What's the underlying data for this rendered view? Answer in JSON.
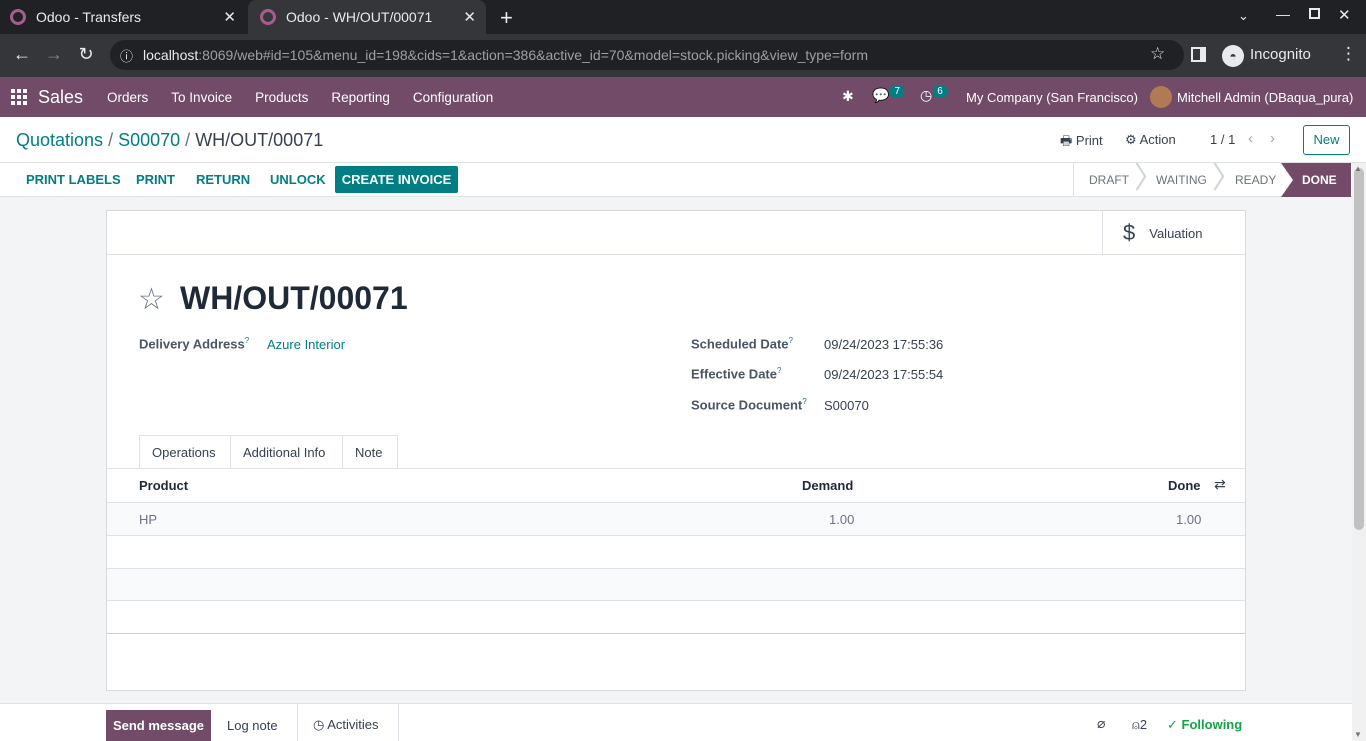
{
  "browser": {
    "tabs": [
      {
        "title": "Odoo - Transfers",
        "active": false
      },
      {
        "title": "Odoo - WH/OUT/00071",
        "active": true
      }
    ],
    "url_host": "localhost",
    "url_rest": ":8069/web#id=105&menu_id=198&cids=1&action=386&active_id=70&model=stock.picking&view_type=form",
    "incognito_label": "Incognito"
  },
  "navbar": {
    "app": "Sales",
    "menus": [
      "Orders",
      "To Invoice",
      "Products",
      "Reporting",
      "Configuration"
    ],
    "messages_count": "7",
    "activities_count": "6",
    "company": "My Company (San Francisco)",
    "user": "Mitchell Admin (DBaqua_pura)"
  },
  "control_panel": {
    "breadcrumb": [
      "Quotations",
      "S00070",
      "WH/OUT/00071"
    ],
    "print_label": "Print",
    "action_label": "Action",
    "pager": "1 / 1",
    "new_label": "New"
  },
  "statusbar": {
    "buttons": [
      "Print Labels",
      "Print",
      "Return",
      "Unlock"
    ],
    "create_invoice": "Create Invoice",
    "stages": [
      "DRAFT",
      "WAITING",
      "READY",
      "DONE"
    ],
    "current_stage": "DONE"
  },
  "form": {
    "valuation_label": "Valuation",
    "name": "WH/OUT/00071",
    "delivery_address_label": "Delivery Address",
    "delivery_address": "Azure Interior",
    "scheduled_date_label": "Scheduled Date",
    "scheduled_date": "09/24/2023 17:55:36",
    "effective_date_label": "Effective Date",
    "effective_date": "09/24/2023 17:55:54",
    "source_document_label": "Source Document",
    "source_document": "S00070",
    "tabs": [
      "Operations",
      "Additional Info",
      "Note"
    ],
    "columns": [
      "Product",
      "Demand",
      "Done"
    ],
    "lines": [
      {
        "product": "HP",
        "demand": "1.00",
        "done": "1.00"
      }
    ]
  },
  "chatter": {
    "send_message": "Send message",
    "log_note": "Log note",
    "activities": "Activities",
    "followers_count": "2",
    "following": "Following"
  }
}
